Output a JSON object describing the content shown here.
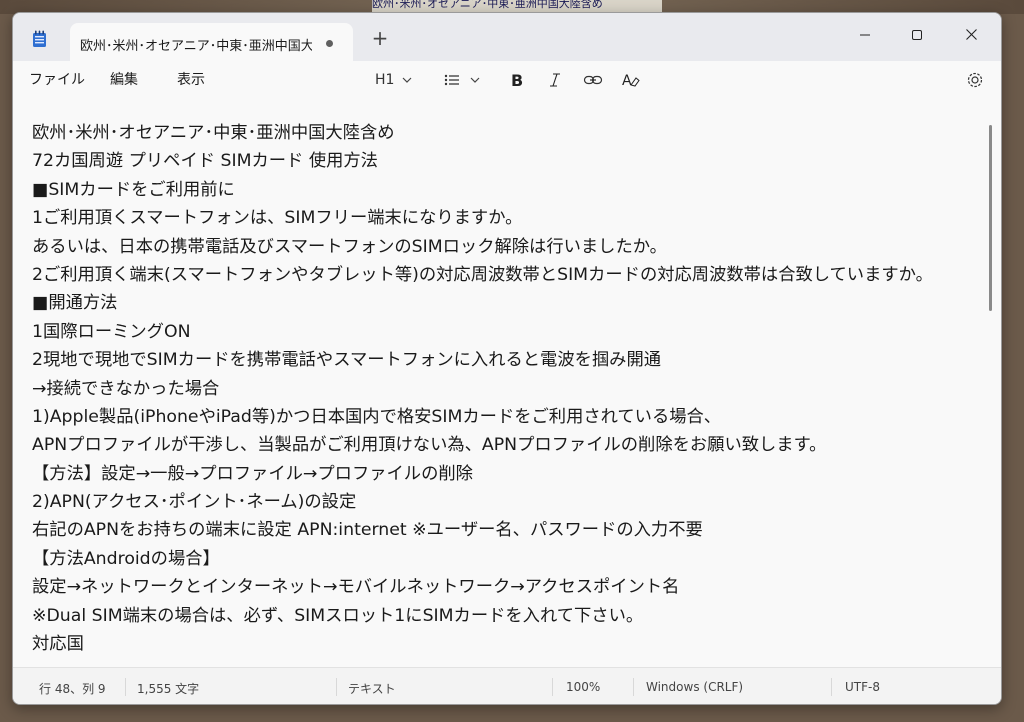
{
  "background": {
    "snippet_text": "欧州･米州･オセアニア･中東･亜洲中国大陸含め"
  },
  "window": {
    "tab_title": "欧州･米州･オセアニア･中東･亜洲中国大陸含め",
    "new_tab_label": "+",
    "controls": [
      "minimize-icon",
      "maximize-icon",
      "close-icon"
    ]
  },
  "menu": {
    "file": "ファイル",
    "edit": "編集",
    "view": "表示"
  },
  "toolbar": {
    "heading": "H1",
    "icons": [
      "chevron-down-icon",
      "list-icon",
      "bold-icon",
      "italic-icon",
      "link-icon",
      "clear-format-icon",
      "gear-icon"
    ]
  },
  "document": {
    "lines": [
      "欧州･米州･オセアニア･中東･亜洲中国大陸含め",
      "72カ国周遊 プリペイド SIMカード 使用方法",
      "■SIMカードをご利用前に",
      "1ご利用頂くスマートフォンは、SIMフリー端末になりますか。",
      "あるいは、日本の携帯電話及びスマートフォンのSIMロック解除は行いましたか。",
      "2ご利用頂く端末(スマートフォンやタブレット等)の対応周波数帯とSIMカードの対応周波数帯は合致していますか。",
      "■開通方法",
      "1国際ローミングON",
      "2現地で現地でSIMカードを携帯電話やスマートフォンに入れると電波を掴み開通",
      "→接続できなかった場合",
      "1)Apple製品(iPhoneやiPad等)かつ日本国内で格安SIMカードをご利用されている場合、",
      "APNプロファイルが干渉し、当製品がご利用頂けない為、APNプロファイルの削除をお願い致します。",
      "【方法】設定→一般→プロファイル→プロファイルの削除",
      "2)APN(アクセス･ポイント･ネーム)の設定",
      "右記のAPNをお持ちの端末に設定 APN:internet ※ユーザー名、パスワードの入力不要",
      "【方法Androidの場合】",
      "設定→ネットワークとインターネット→モバイルネットワーク→アクセスポイント名",
      "※Dual SIM端末の場合は、必ず、SIMスロット1にSIMカードを入れて下さい。",
      "対応国"
    ]
  },
  "status": {
    "position": "行 48、列 9",
    "char_count": "1,555 文字",
    "format": "テキスト",
    "zoom": "100%",
    "line_ending": "Windows (CRLF)",
    "encoding": "UTF-8"
  }
}
